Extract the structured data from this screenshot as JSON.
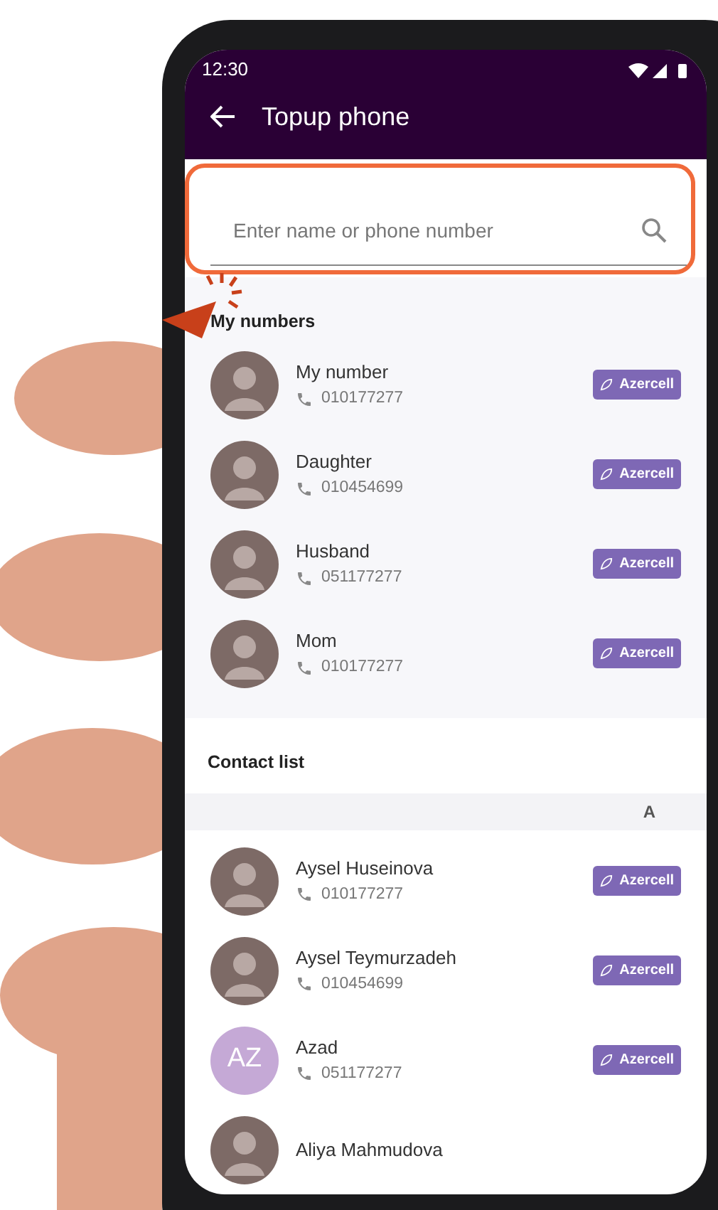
{
  "status_bar": {
    "time": "12:30"
  },
  "header": {
    "title": "Topup phone"
  },
  "search": {
    "placeholder": "Enter name or phone number",
    "highlighted": true
  },
  "my_numbers": {
    "title": "My numbers",
    "contacts": [
      {
        "name": "My number",
        "phone": "010177277",
        "operator": "Azercell",
        "avatar": {
          "kind": "photo"
        }
      },
      {
        "name": "Daughter",
        "phone": "010454699",
        "operator": "Azercell",
        "avatar": {
          "kind": "photo"
        }
      },
      {
        "name": "Husband",
        "phone": "051177277",
        "operator": "Azercell",
        "avatar": {
          "kind": "photo"
        }
      },
      {
        "name": "Mom",
        "phone": "010177277",
        "operator": "Azercell",
        "avatar": {
          "kind": "photo"
        }
      }
    ]
  },
  "contact_list": {
    "title": "Contact list",
    "groups": [
      {
        "letter": "A",
        "contacts": [
          {
            "name": "Aysel Huseinova",
            "phone": "010177277",
            "operator": "Azercell",
            "avatar": {
              "kind": "photo"
            }
          },
          {
            "name": "Aysel Teymurzadeh",
            "phone": "010454699",
            "operator": "Azercell",
            "avatar": {
              "kind": "photo"
            }
          },
          {
            "name": "Azad",
            "phone": "051177277",
            "operator": "Azercell",
            "avatar": {
              "kind": "initials",
              "text": "AZ"
            }
          },
          {
            "name": "Aliya Mahmudova",
            "avatar": {
              "kind": "photo"
            }
          }
        ]
      }
    ]
  }
}
